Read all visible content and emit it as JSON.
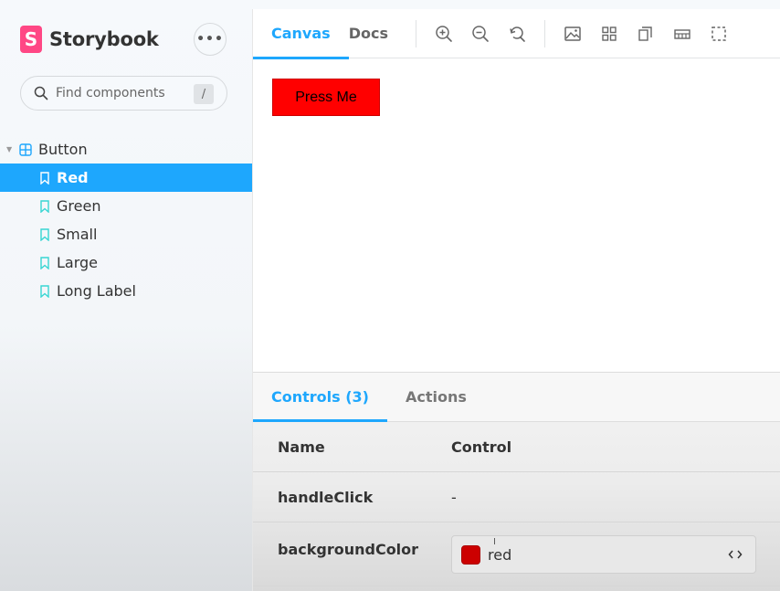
{
  "app": {
    "name": "Storybook",
    "menu_glyph": "•••"
  },
  "search": {
    "placeholder": "Find components",
    "shortcut": "/"
  },
  "tree": {
    "component": {
      "label": "Button",
      "caret": "▼"
    },
    "stories": [
      {
        "label": "Red",
        "selected": true
      },
      {
        "label": "Green"
      },
      {
        "label": "Small"
      },
      {
        "label": "Large"
      },
      {
        "label": "Long Label"
      }
    ]
  },
  "toolbar": {
    "tabs": [
      {
        "label": "Canvas",
        "active": true
      },
      {
        "label": "Docs"
      }
    ],
    "tools": [
      "zoom-in-icon",
      "zoom-out-icon",
      "reset-zoom-icon",
      "background-icon",
      "grid-icon",
      "viewport-icon",
      "measure-icon",
      "outline-icon"
    ]
  },
  "preview": {
    "button_label": "Press Me",
    "button_color": "#ff0000"
  },
  "addons": {
    "tabs": [
      {
        "label": "Controls (3)",
        "active": true
      },
      {
        "label": "Actions"
      }
    ],
    "headers": {
      "name": "Name",
      "control": "Control"
    },
    "rows": [
      {
        "name": "handleClick",
        "control": "-"
      },
      {
        "name": "backgroundColor",
        "control": "red",
        "swatch": "#cc0000"
      }
    ],
    "cursor_glyph": "I"
  },
  "colors": {
    "accent": "#1ea7fd",
    "brand": "#ff4785"
  }
}
